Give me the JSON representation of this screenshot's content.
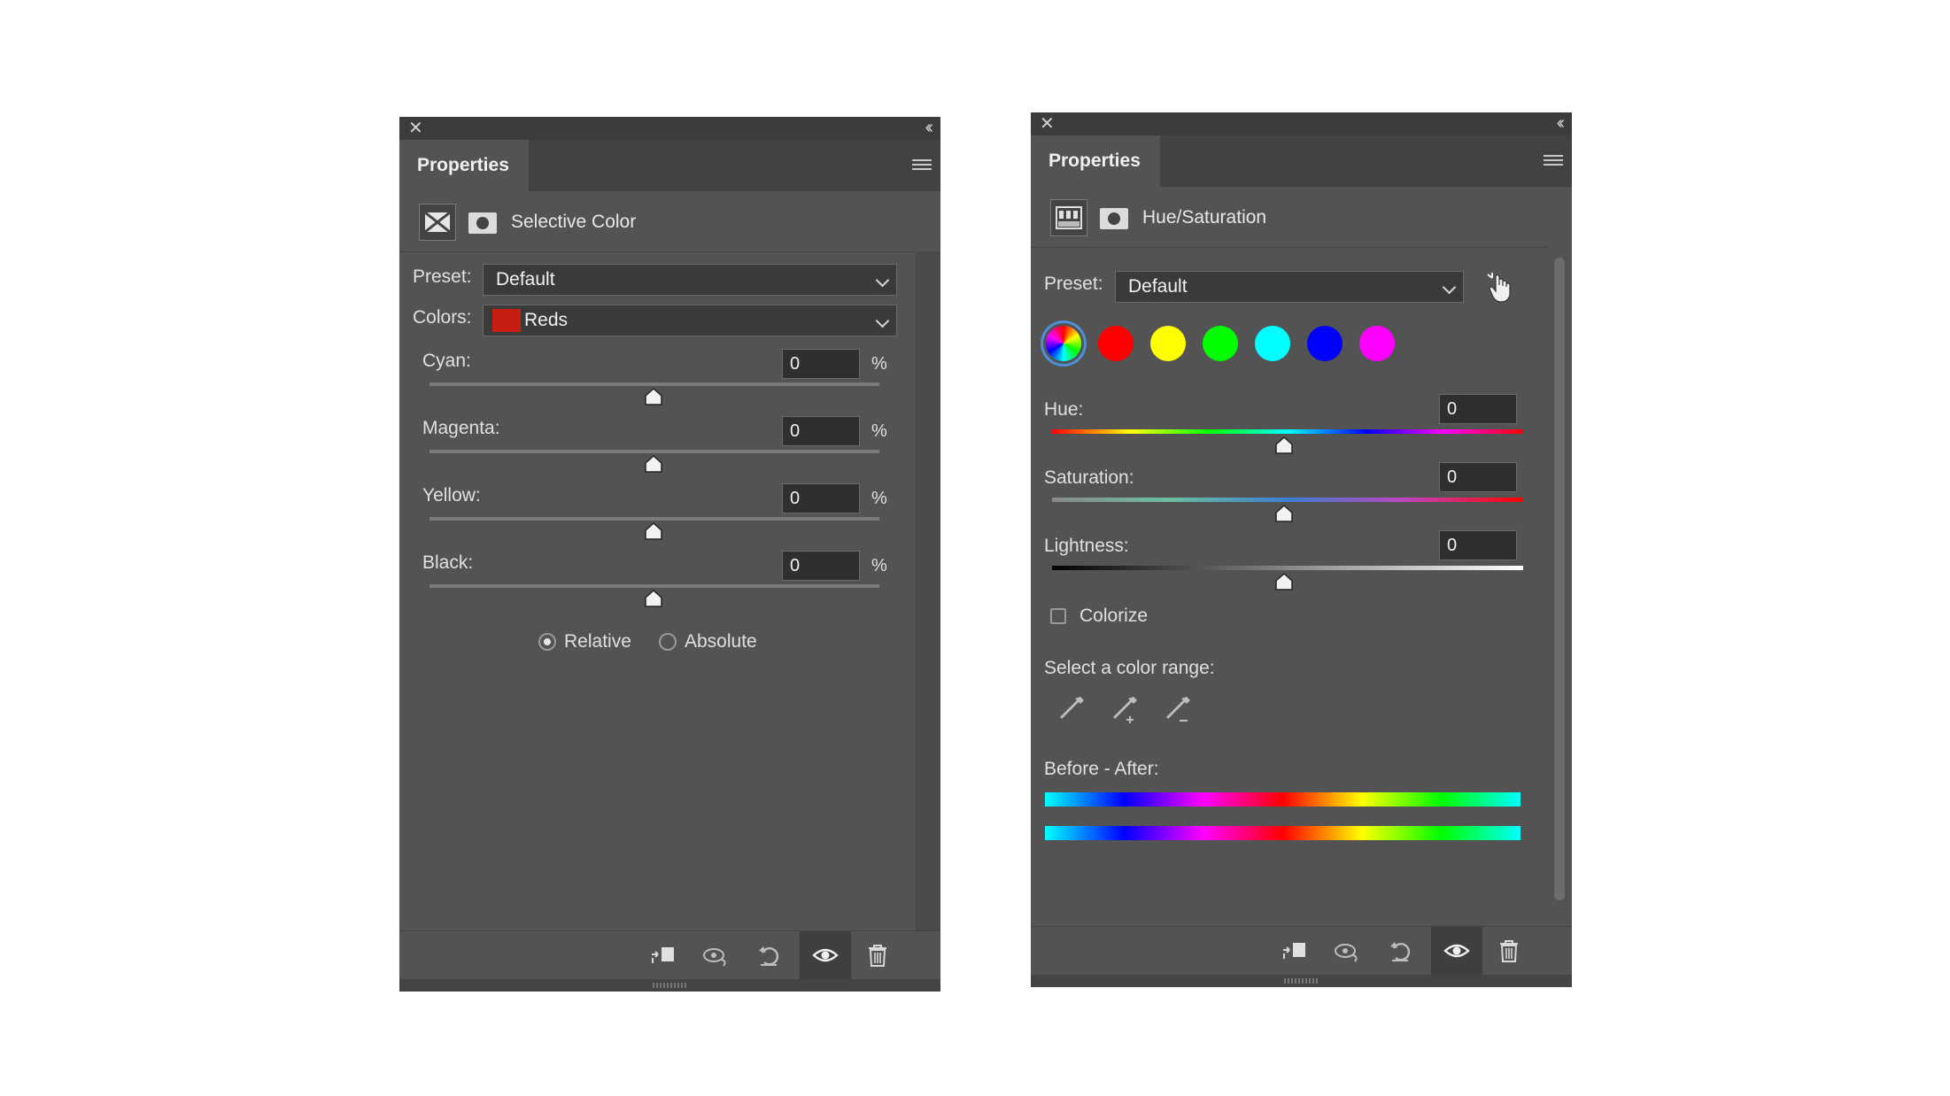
{
  "panel_left": {
    "tab_title": "Properties",
    "adjustment_title": "Selective Color",
    "preset_label": "Preset:",
    "preset_value": "Default",
    "colors_label": "Colors:",
    "colors_value": "Reds",
    "colors_swatch": "#c81e12",
    "sliders": [
      {
        "label": "Cyan:",
        "value": "0",
        "unit": "%"
      },
      {
        "label": "Magenta:",
        "value": "0",
        "unit": "%"
      },
      {
        "label": "Yellow:",
        "value": "0",
        "unit": "%"
      },
      {
        "label": "Black:",
        "value": "0",
        "unit": "%"
      }
    ],
    "method_options": [
      {
        "label": "Relative",
        "selected": true
      },
      {
        "label": "Absolute",
        "selected": false
      }
    ]
  },
  "panel_right": {
    "tab_title": "Properties",
    "adjustment_title": "Hue/Saturation",
    "preset_label": "Preset:",
    "preset_value": "Default",
    "color_circles": [
      "master",
      "#ff0000",
      "#ffff00",
      "#00ff00",
      "#00ffff",
      "#0000ff",
      "#ff00ff"
    ],
    "sliders": [
      {
        "label": "Hue:",
        "value": "0"
      },
      {
        "label": "Saturation:",
        "value": "0"
      },
      {
        "label": "Lightness:",
        "value": "0"
      }
    ],
    "colorize_label": "Colorize",
    "color_range_label": "Select a color range:",
    "before_after_label": "Before - After:"
  },
  "footer_icons": [
    "clip-to-layer-icon",
    "view-previous-state-icon",
    "reset-icon",
    "visibility-eye-icon",
    "trash-icon"
  ]
}
